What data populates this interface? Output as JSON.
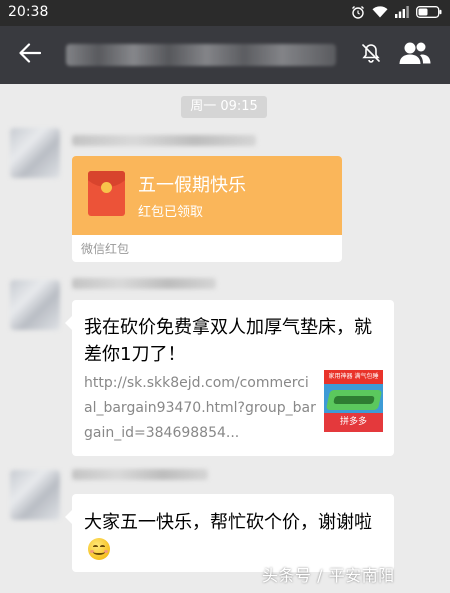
{
  "status_bar": {
    "time": "20:38",
    "icons": [
      "alarm-icon",
      "wifi-icon",
      "signal-icon",
      "battery-icon"
    ]
  },
  "nav": {
    "back_icon": "arrow-left-icon",
    "mute_icon": "bell-muted-icon",
    "contacts_icon": "group-contacts-icon"
  },
  "messages": {
    "timestamp": "周一 09:15",
    "red_packet": {
      "title": "五一假期快乐",
      "status": "红包已领取",
      "footer": "微信红包"
    },
    "link_card": {
      "title": "我在砍价免费拿双人加厚气垫床，就差你1刀了！",
      "url": "http://sk.skk8ejd.com/commercial_bargain93470.html?group_bargain_id=384698854...",
      "thumb_banner": "家用神器 满气包睡",
      "thumb_logo": "拼多多"
    },
    "text_message": {
      "text": "大家五一快乐，帮忙砍个价，谢谢啦"
    }
  },
  "watermark": "头条号 / 平安南阳",
  "colors": {
    "status_bar": "#2b2b2b",
    "nav_bar": "#393a3f",
    "chat_bg": "#ebebeb",
    "red_packet": "#fab65a",
    "envelope": "#ec5338"
  }
}
